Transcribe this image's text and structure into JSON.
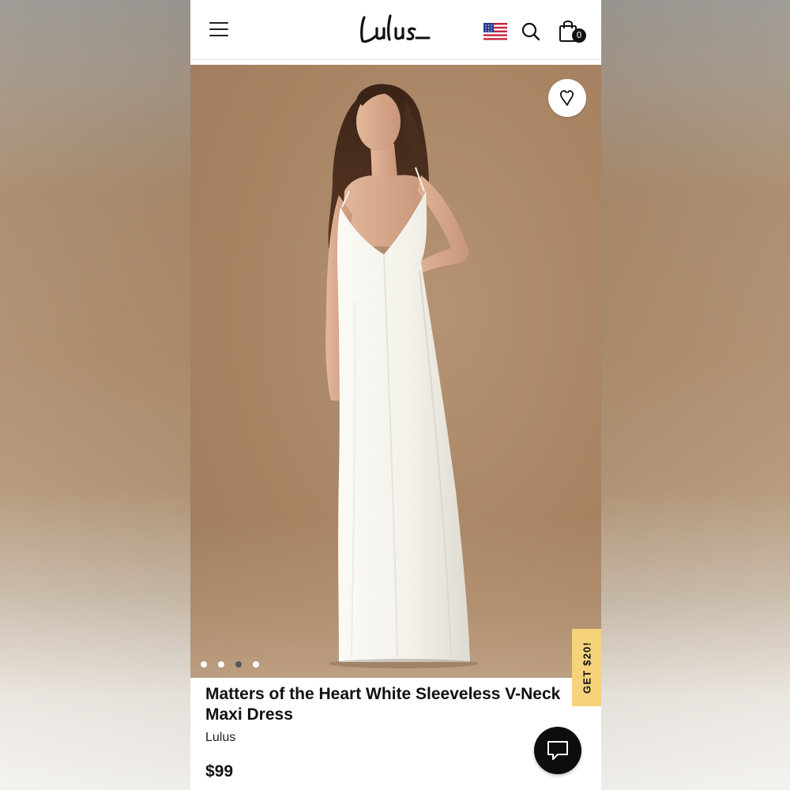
{
  "header": {
    "logo_text": "Lulus",
    "menu_icon": "hamburger-menu-icon",
    "flag_icon": "us-flag-icon",
    "search_icon": "search-icon",
    "cart_icon": "shopping-bag-icon",
    "cart_count": "0"
  },
  "gallery": {
    "wishlist_icon": "heart-icon",
    "dots": [
      {
        "active": false
      },
      {
        "active": false
      },
      {
        "active": true
      },
      {
        "active": false
      }
    ]
  },
  "promo": {
    "label": "GET $20!",
    "color": "#f6d37a"
  },
  "product": {
    "title": "Matters of the Heart White Sleeveless V-Neck Maxi Dress",
    "brand": "Lulus",
    "price": "$99"
  },
  "chat": {
    "icon": "chat-bubble-icon"
  },
  "colors": {
    "backdrop": "#a8896a",
    "ink": "#111111"
  }
}
